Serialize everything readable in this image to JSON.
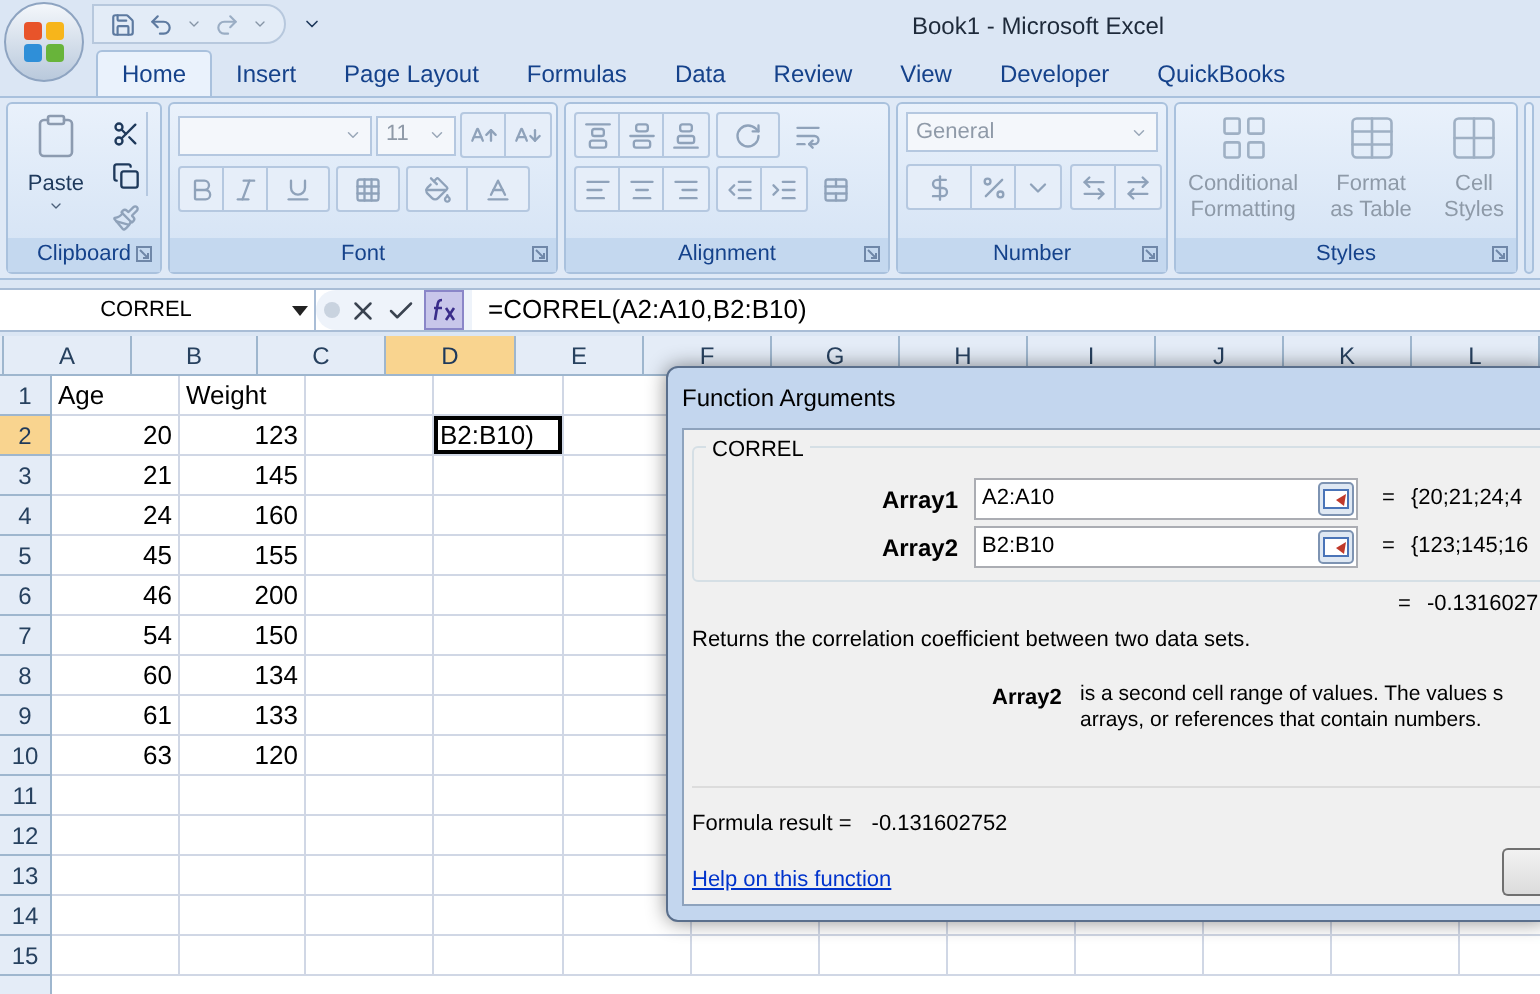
{
  "window": {
    "title": "Book1  -  Microsoft Excel"
  },
  "tabs": [
    {
      "label": "Home",
      "selected": true
    },
    {
      "label": "Insert",
      "selected": false
    },
    {
      "label": "Page Layout",
      "selected": false
    },
    {
      "label": "Formulas",
      "selected": false
    },
    {
      "label": "Data",
      "selected": false
    },
    {
      "label": "Review",
      "selected": false
    },
    {
      "label": "View",
      "selected": false
    },
    {
      "label": "Developer",
      "selected": false
    },
    {
      "label": "QuickBooks",
      "selected": false
    }
  ],
  "ribbon": {
    "disabled": true,
    "groups": [
      {
        "kind": "clipboard",
        "label": "Clipboard",
        "paste": "Paste"
      },
      {
        "kind": "font",
        "label": "Font",
        "font_size": "11"
      },
      {
        "kind": "alignment",
        "label": "Alignment"
      },
      {
        "kind": "number",
        "label": "Number",
        "format": "General"
      },
      {
        "kind": "styles",
        "label": "Styles",
        "buttons": [
          {
            "lines": [
              "Conditional",
              "Formatting"
            ]
          },
          {
            "lines": [
              "Format",
              "as Table"
            ]
          },
          {
            "lines": [
              "Cell",
              "Styles"
            ]
          }
        ]
      }
    ]
  },
  "formula_bar": {
    "name_box": "CORREL",
    "formula": "=CORREL(A2:A10,B2:B10)"
  },
  "sheet": {
    "columns": [
      {
        "label": "A",
        "selected": false
      },
      {
        "label": "B",
        "selected": false
      },
      {
        "label": "C",
        "selected": false
      },
      {
        "label": "D",
        "selected": true
      },
      {
        "label": "E",
        "selected": false
      },
      {
        "label": "F",
        "selected": false
      },
      {
        "label": "G",
        "selected": false
      },
      {
        "label": "H",
        "selected": false
      },
      {
        "label": "I",
        "selected": false
      },
      {
        "label": "J",
        "selected": false
      },
      {
        "label": "K",
        "selected": false
      },
      {
        "label": "L",
        "selected": false
      }
    ],
    "active_cell": {
      "text": "B2:B10)"
    },
    "rows": [
      {
        "header": "1",
        "selected": false,
        "cells": [
          {
            "text": "Age",
            "kind": "text"
          },
          {
            "text": "Weight",
            "kind": "text"
          }
        ]
      },
      {
        "header": "2",
        "selected": true,
        "cells": [
          {
            "text": "20",
            "kind": "number"
          },
          {
            "text": "123",
            "kind": "number"
          }
        ]
      },
      {
        "header": "3",
        "selected": false,
        "cells": [
          {
            "text": "21",
            "kind": "number"
          },
          {
            "text": "145",
            "kind": "number"
          }
        ]
      },
      {
        "header": "4",
        "selected": false,
        "cells": [
          {
            "text": "24",
            "kind": "number"
          },
          {
            "text": "160",
            "kind": "number"
          }
        ]
      },
      {
        "header": "5",
        "selected": false,
        "cells": [
          {
            "text": "45",
            "kind": "number"
          },
          {
            "text": "155",
            "kind": "number"
          }
        ]
      },
      {
        "header": "6",
        "selected": false,
        "cells": [
          {
            "text": "46",
            "kind": "number"
          },
          {
            "text": "200",
            "kind": "number"
          }
        ]
      },
      {
        "header": "7",
        "selected": false,
        "cells": [
          {
            "text": "54",
            "kind": "number"
          },
          {
            "text": "150",
            "kind": "number"
          }
        ]
      },
      {
        "header": "8",
        "selected": false,
        "cells": [
          {
            "text": "60",
            "kind": "number"
          },
          {
            "text": "134",
            "kind": "number"
          }
        ]
      },
      {
        "header": "9",
        "selected": false,
        "cells": [
          {
            "text": "61",
            "kind": "number"
          },
          {
            "text": "133",
            "kind": "number"
          }
        ]
      },
      {
        "header": "10",
        "selected": false,
        "cells": [
          {
            "text": "63",
            "kind": "number"
          },
          {
            "text": "120",
            "kind": "number"
          }
        ]
      },
      {
        "header": "11",
        "selected": false,
        "cells": []
      },
      {
        "header": "12",
        "selected": false,
        "cells": []
      },
      {
        "header": "13",
        "selected": false,
        "cells": []
      },
      {
        "header": "14",
        "selected": false,
        "cells": []
      },
      {
        "header": "15",
        "selected": false,
        "cells": []
      }
    ]
  },
  "dialog": {
    "title": "Function Arguments",
    "function_name": "CORREL",
    "arguments": [
      {
        "label": "Array1",
        "value": "A2:A10",
        "equals": "=",
        "result": "{20;21;24;4"
      },
      {
        "label": "Array2",
        "value": "B2:B10",
        "equals": "=",
        "result": "{123;145;16"
      }
    ],
    "result_preview": {
      "equals": "=",
      "value": "-0.1316027"
    },
    "description": "Returns the correlation coefficient between two data sets.",
    "argument_help": {
      "name": "Array2",
      "lines": [
        "is a second cell range of values. The values s",
        "arrays, or references that contain numbers."
      ]
    },
    "formula_result": {
      "label": "Formula result =",
      "value": "-0.131602752"
    },
    "help_link": "Help on this function"
  }
}
